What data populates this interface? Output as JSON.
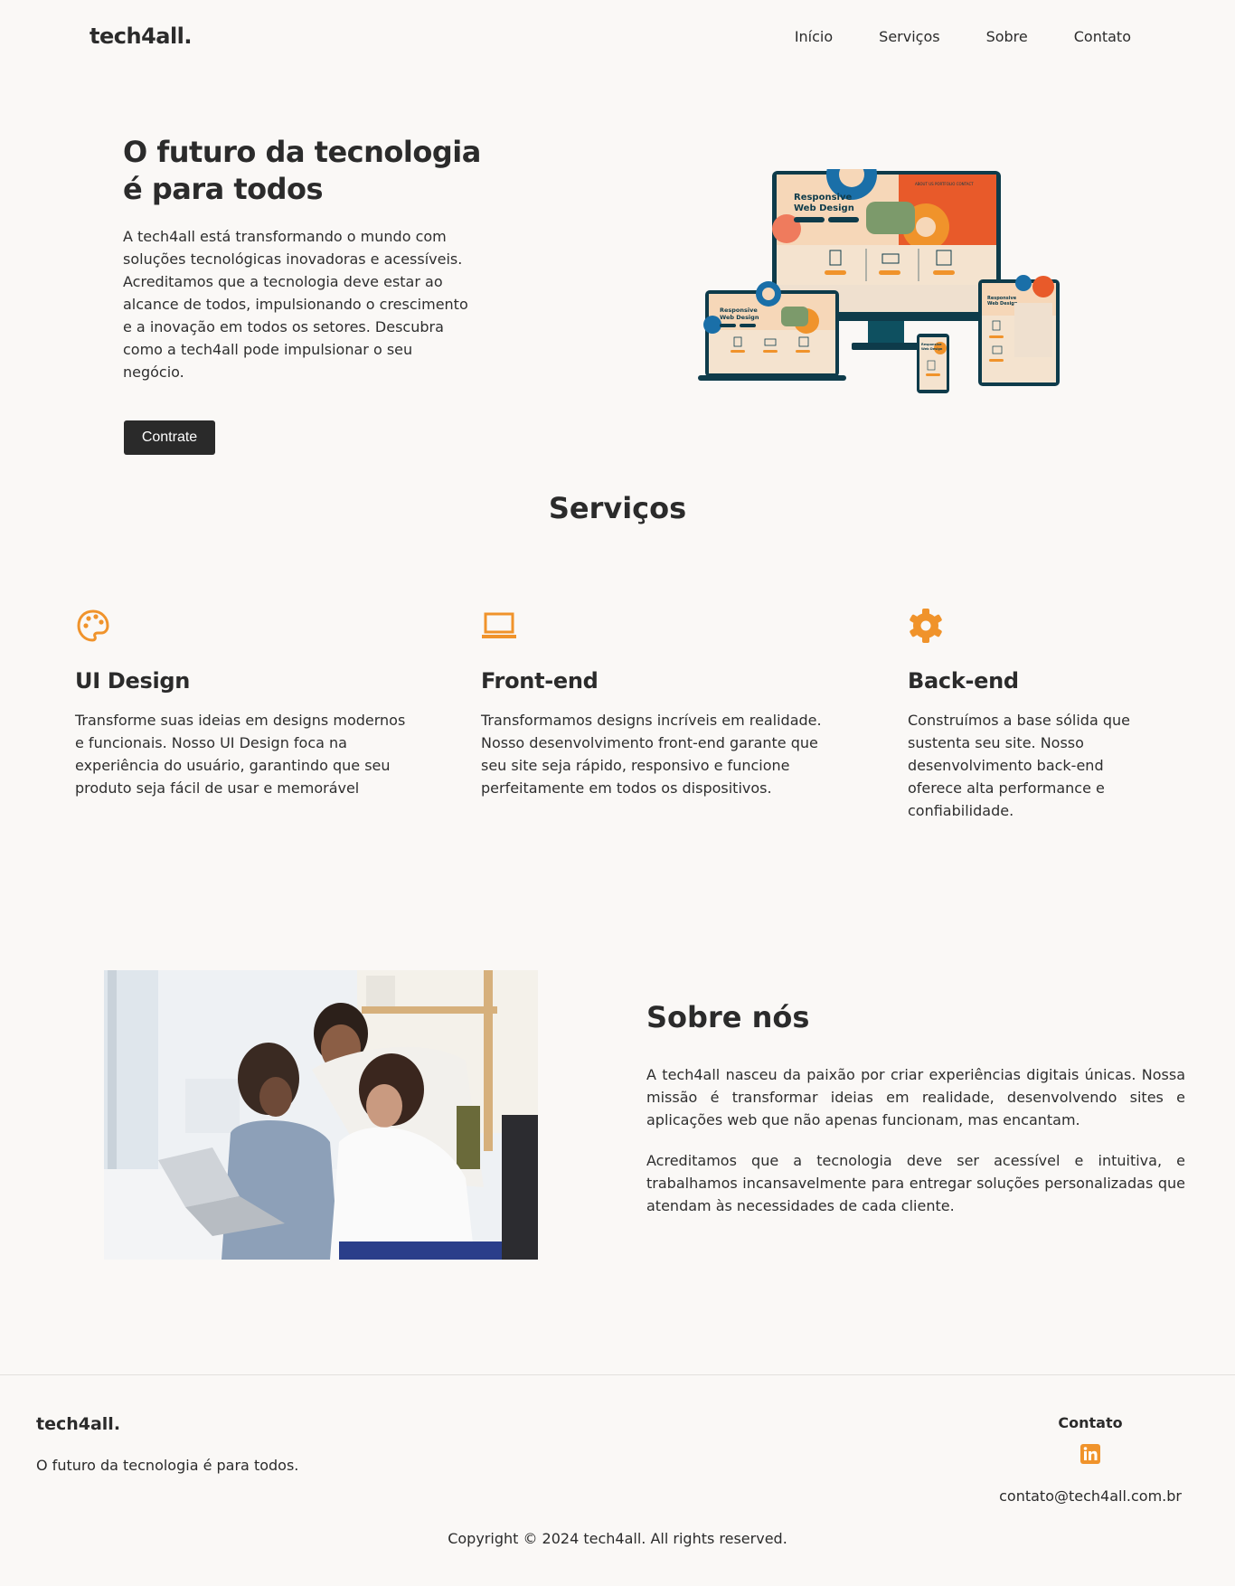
{
  "brand": {
    "logo": "tech4all.",
    "accent": "#f0932b",
    "dark": "#2a2a2a",
    "background": "#faf8f6"
  },
  "nav": {
    "items": [
      "Início",
      "Serviços",
      "Sobre",
      "Contato"
    ]
  },
  "hero": {
    "title": "O futuro da tecnologia é para todos",
    "text": "A tech4all está transformando o mundo com soluções tecnológicas inovadoras e acessíveis. Acreditamos que a tecnologia deve estar ao alcance de todos, impulsionando o crescimento e a inovação em todos os setores. Descubra como a tech4all pode impulsionar o seu negócio.",
    "button": "Contrate",
    "illustration": {
      "monitor_title": "Responsive Web Design",
      "laptop_title": "Responsive Web Design",
      "tablet_title": "Responsive Web Design",
      "phone_title": "Responsive Web Design",
      "monitor_nav": [
        "ABOUT US",
        "PORTFOLIO",
        "CONTACT"
      ],
      "monitor_buttons": [
        "LEARN MORE",
        "LEARN MORE",
        "LEARN MORE"
      ]
    }
  },
  "services": {
    "title": "Serviços",
    "items": [
      {
        "icon": "palette-icon",
        "title": "UI Design",
        "text": "Transforme suas ideias em designs modernos e funcionais. Nosso UI Design foca na experiência do usuário, garantindo que seu produto seja fácil de usar e memorável"
      },
      {
        "icon": "laptop-icon",
        "title": "Front-end",
        "text": "Transformamos designs incríveis em realidade. Nosso desenvolvimento front-end garante que seu site seja rápido, responsivo e funcione perfeitamente em todos os dispositivos."
      },
      {
        "icon": "gear-icon",
        "title": "Back-end",
        "text": "Construímos a base sólida que sustenta seu site. Nosso desenvolvimento back-end oferece alta performance e confiabilidade."
      }
    ]
  },
  "about": {
    "title": "Sobre nós",
    "paragraphs": [
      "A tech4all nasceu da paixão por criar experiências digitais únicas. Nossa missão é transformar ideias em realidade, desenvolvendo sites e aplicações web que não apenas funcionam, mas encantam.",
      "Acreditamos que a tecnologia deve ser acessível e intuitiva, e trabalhamos incansavelmente para entregar soluções personalizadas que atendam às necessidades de cada cliente."
    ]
  },
  "footer": {
    "logo": "tech4all.",
    "tagline": "O futuro da tecnologia é para todos.",
    "contact_title": "Contato",
    "social_icon": "linkedin-icon",
    "email": "contato@tech4all.com.br",
    "copyright": "Copyright © 2024 tech4all. All rights reserved."
  }
}
